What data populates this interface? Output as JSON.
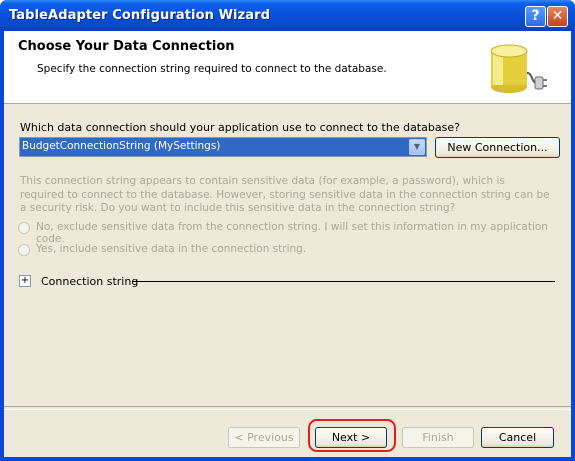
{
  "window": {
    "title": "TableAdapter Configuration Wizard"
  },
  "titlebar": {
    "help_glyph": "?",
    "close_glyph": "✕"
  },
  "header": {
    "title": "Choose Your Data Connection",
    "subtitle": "Specify the connection string required to connect to the database.",
    "icon": "database-plug-icon"
  },
  "connection": {
    "question": "Which data connection should your application use to connect to the database?",
    "selected": "BudgetConnectionString (MySettings)",
    "new_button": "New Connection..."
  },
  "sensitive": {
    "notice": "This connection string appears to contain sensitive data (for example, a password), which is required to connect to the database. However, storing sensitive data in the connection string can be a security risk. Do you want to include this sensitive data in the connection string?",
    "option_exclude": "No, exclude sensitive data from the connection string. I will set this information in my application code.",
    "option_include": "Yes, include sensitive data in the connection string."
  },
  "connection_string": {
    "expander_glyph": "+",
    "label": "Connection string"
  },
  "footer": {
    "previous": "< Previous",
    "next": "Next >",
    "finish": "Finish",
    "cancel": "Cancel"
  },
  "colors": {
    "titlebar": "#0a4fd8",
    "selection": "#316ac5",
    "highlight": "#d9201d"
  }
}
